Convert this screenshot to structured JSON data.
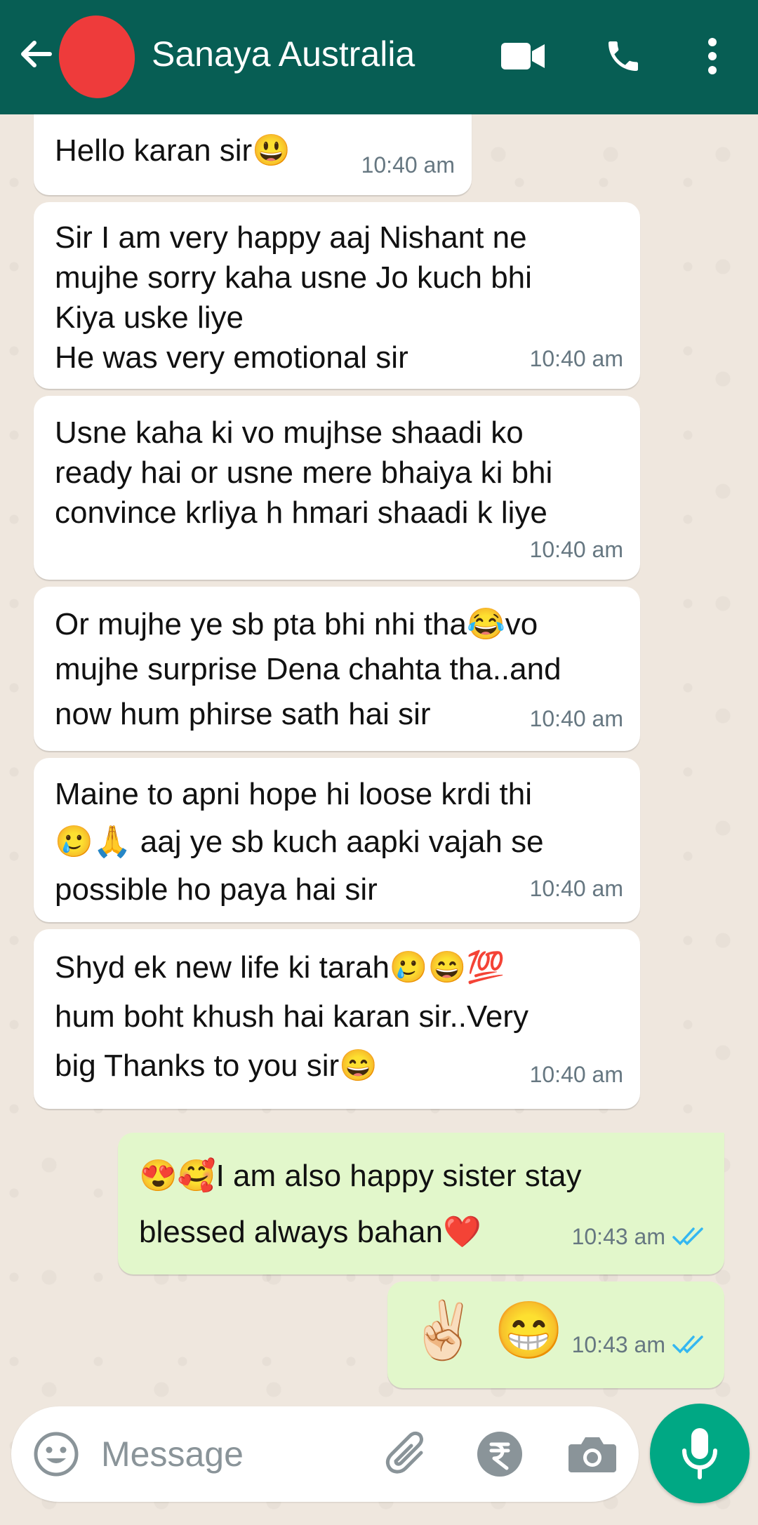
{
  "header": {
    "contact_name": "Sanaya Australia",
    "icons": [
      "back-arrow-icon",
      "video-call-icon",
      "voice-call-icon",
      "more-options-icon"
    ],
    "bar_color": "#075e54"
  },
  "messages": [
    {
      "direction": "in",
      "text": "Hello karan sir😃",
      "time": "10:40 am"
    },
    {
      "direction": "in",
      "text": "Sir I am very happy aaj Nishant ne\nmujhe sorry kaha usne Jo kuch bhi\nKiya uske liye\nHe was very emotional sir",
      "time": "10:40 am"
    },
    {
      "direction": "in",
      "text": "Usne kaha ki vo mujhse shaadi ko\nready hai or usne mere bhaiya ki bhi\nconvince krliya h hmari shaadi k liye",
      "time": "10:40 am"
    },
    {
      "direction": "in",
      "text": "Or mujhe ye sb pta bhi nhi tha😂vo\nmujhe surprise Dena chahta tha..and\nnow hum phirse sath hai sir",
      "time": "10:40 am"
    },
    {
      "direction": "in",
      "text": "Maine to apni hope hi loose krdi thi\n🥲🙏 aaj ye sb kuch aapki vajah se\npossible ho paya hai sir",
      "time": "10:40 am"
    },
    {
      "direction": "in",
      "text": "Shyd ek new life ki tarah🥲😄💯\nhum boht khush hai karan sir..Very\nbig Thanks to you sir😄",
      "time": "10:40 am"
    },
    {
      "direction": "out",
      "text": "😍🥰I am also happy sister stay\nblessed always bahan❤️",
      "time": "10:43 am",
      "status": "read"
    },
    {
      "direction": "out",
      "text": "✌🏻 😁",
      "time": "10:43 am",
      "status": "read"
    }
  ],
  "input": {
    "placeholder": "Message",
    "value": ""
  },
  "colors": {
    "incoming_bubble": "#ffffff",
    "outgoing_bubble": "#e2f7cb",
    "read_ticks": "#34b7f1",
    "mic_button": "#00a884"
  }
}
